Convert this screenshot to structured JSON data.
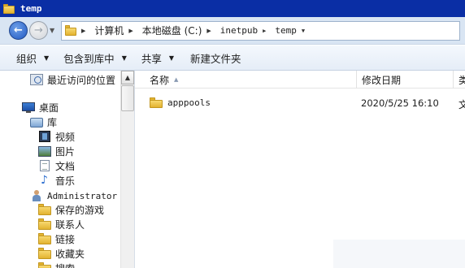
{
  "window": {
    "title": "temp"
  },
  "address": {
    "crumbs": [
      "计算机",
      "本地磁盘 (C:)",
      "inetpub",
      "temp"
    ]
  },
  "toolbar": {
    "organize": "组织",
    "include_in_library": "包含到库中",
    "share": "共享",
    "new_folder": "新建文件夹"
  },
  "nav": {
    "recent": "最近访问的位置",
    "desktop": "桌面",
    "libraries": "库",
    "videos": "视频",
    "pictures": "图片",
    "documents": "文档",
    "music": "音乐",
    "user": "Administrator",
    "saved_games": "保存的游戏",
    "contacts": "联系人",
    "links": "链接",
    "favorites": "收藏夹",
    "searches": "搜索"
  },
  "columns": {
    "name": "名称",
    "date_modified": "修改日期",
    "type": "类"
  },
  "files": [
    {
      "name": "apppools",
      "date": "2020/5/25 16:10",
      "type": "文"
    }
  ],
  "icons": {
    "folder_color": "#e3b330",
    "titlebar_color": "#0a2ea5"
  }
}
